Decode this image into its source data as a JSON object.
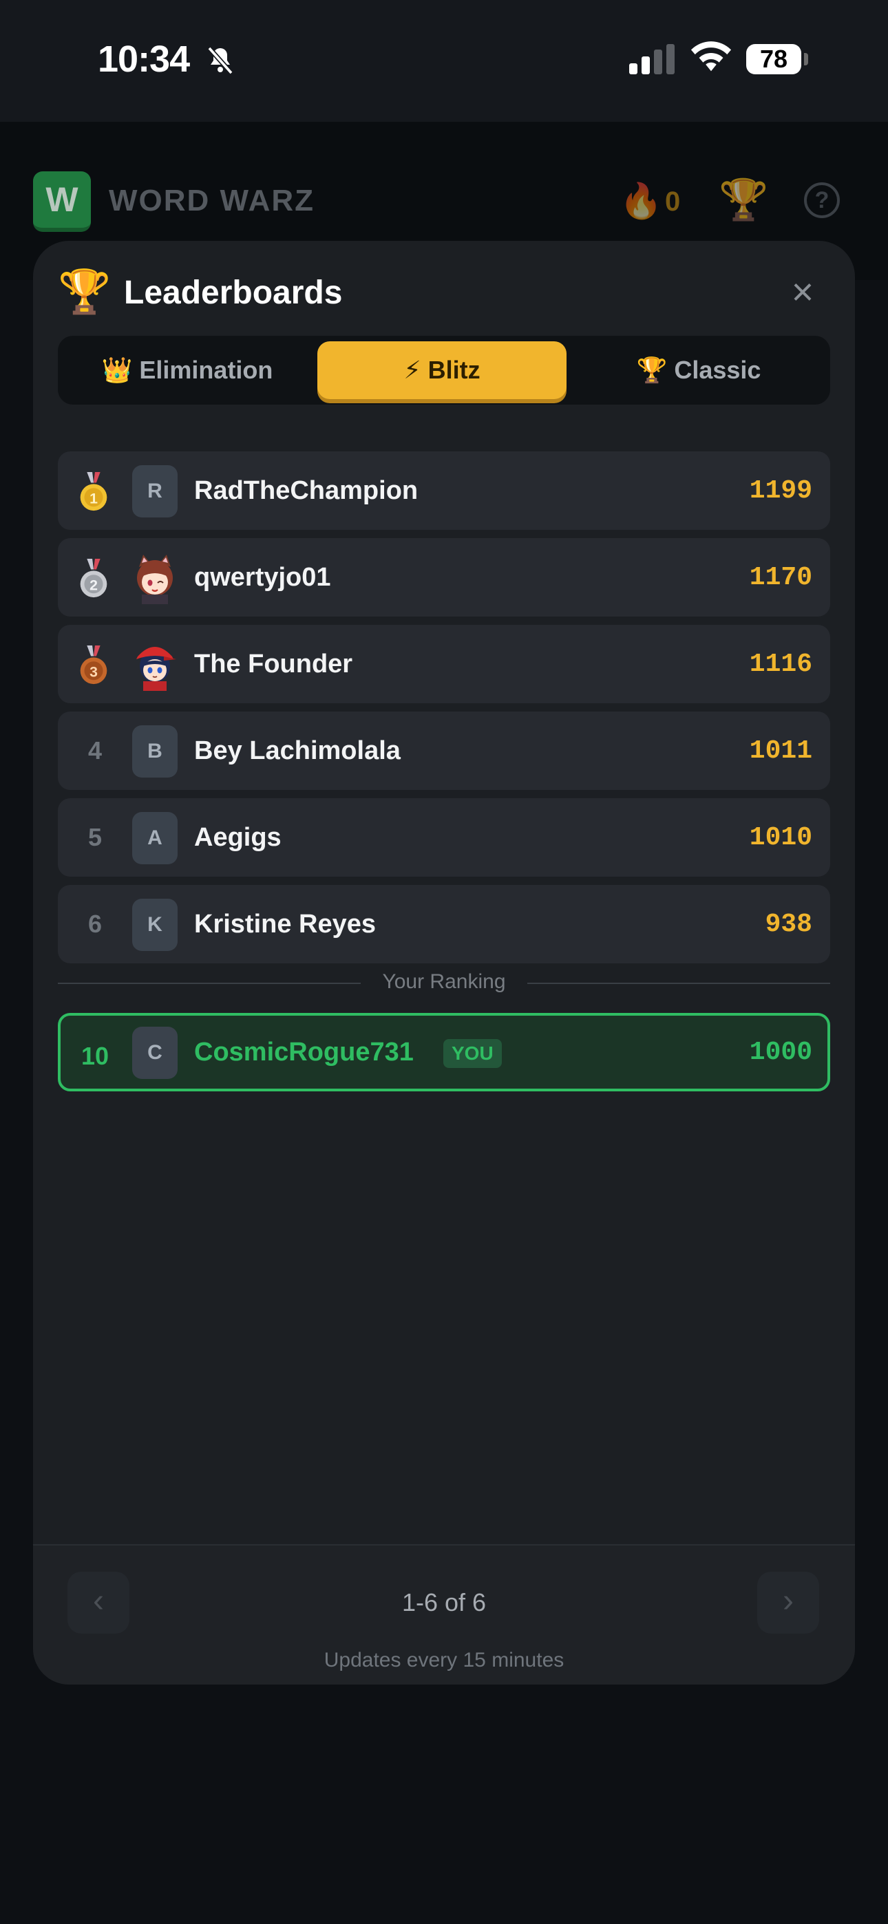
{
  "status_bar": {
    "time": "10:34",
    "battery": "78"
  },
  "app_bar": {
    "logo_letter": "W",
    "title": "WORD WARZ",
    "streak_icon": "fire-icon",
    "streak_count": "0"
  },
  "modal": {
    "title": "Leaderboards",
    "tabs": [
      {
        "label": "👑 Elimination",
        "active": false
      },
      {
        "label": "⚡ Blitz",
        "active": true
      },
      {
        "label": "🏆 Classic",
        "active": false
      }
    ],
    "entries": [
      {
        "rank": "1",
        "initial": "R",
        "name": "RadTheChampion",
        "score": "1199"
      },
      {
        "rank": "2",
        "initial": "",
        "name": "qwertyjo01",
        "score": "1170"
      },
      {
        "rank": "3",
        "initial": "",
        "name": "The Founder",
        "score": "1116"
      },
      {
        "rank": "4",
        "initial": "B",
        "name": "Bey Lachimolala",
        "score": "1011"
      },
      {
        "rank": "5",
        "initial": "A",
        "name": "Aegigs",
        "score": "1010"
      },
      {
        "rank": "6",
        "initial": "K",
        "name": "Kristine Reyes",
        "score": "938"
      }
    ],
    "your_ranking_label": "Your Ranking",
    "you": {
      "rank": "10",
      "initial": "C",
      "name": "CosmicRogue731",
      "badge": "YOU",
      "score": "1000"
    },
    "pagination": {
      "info": "1-6 of 6",
      "prev": "‹",
      "next": "›"
    },
    "update_note": "Updates every 15 minutes"
  },
  "colors": {
    "accent_gold": "#f1b52d",
    "accent_green": "#2fbd62"
  }
}
